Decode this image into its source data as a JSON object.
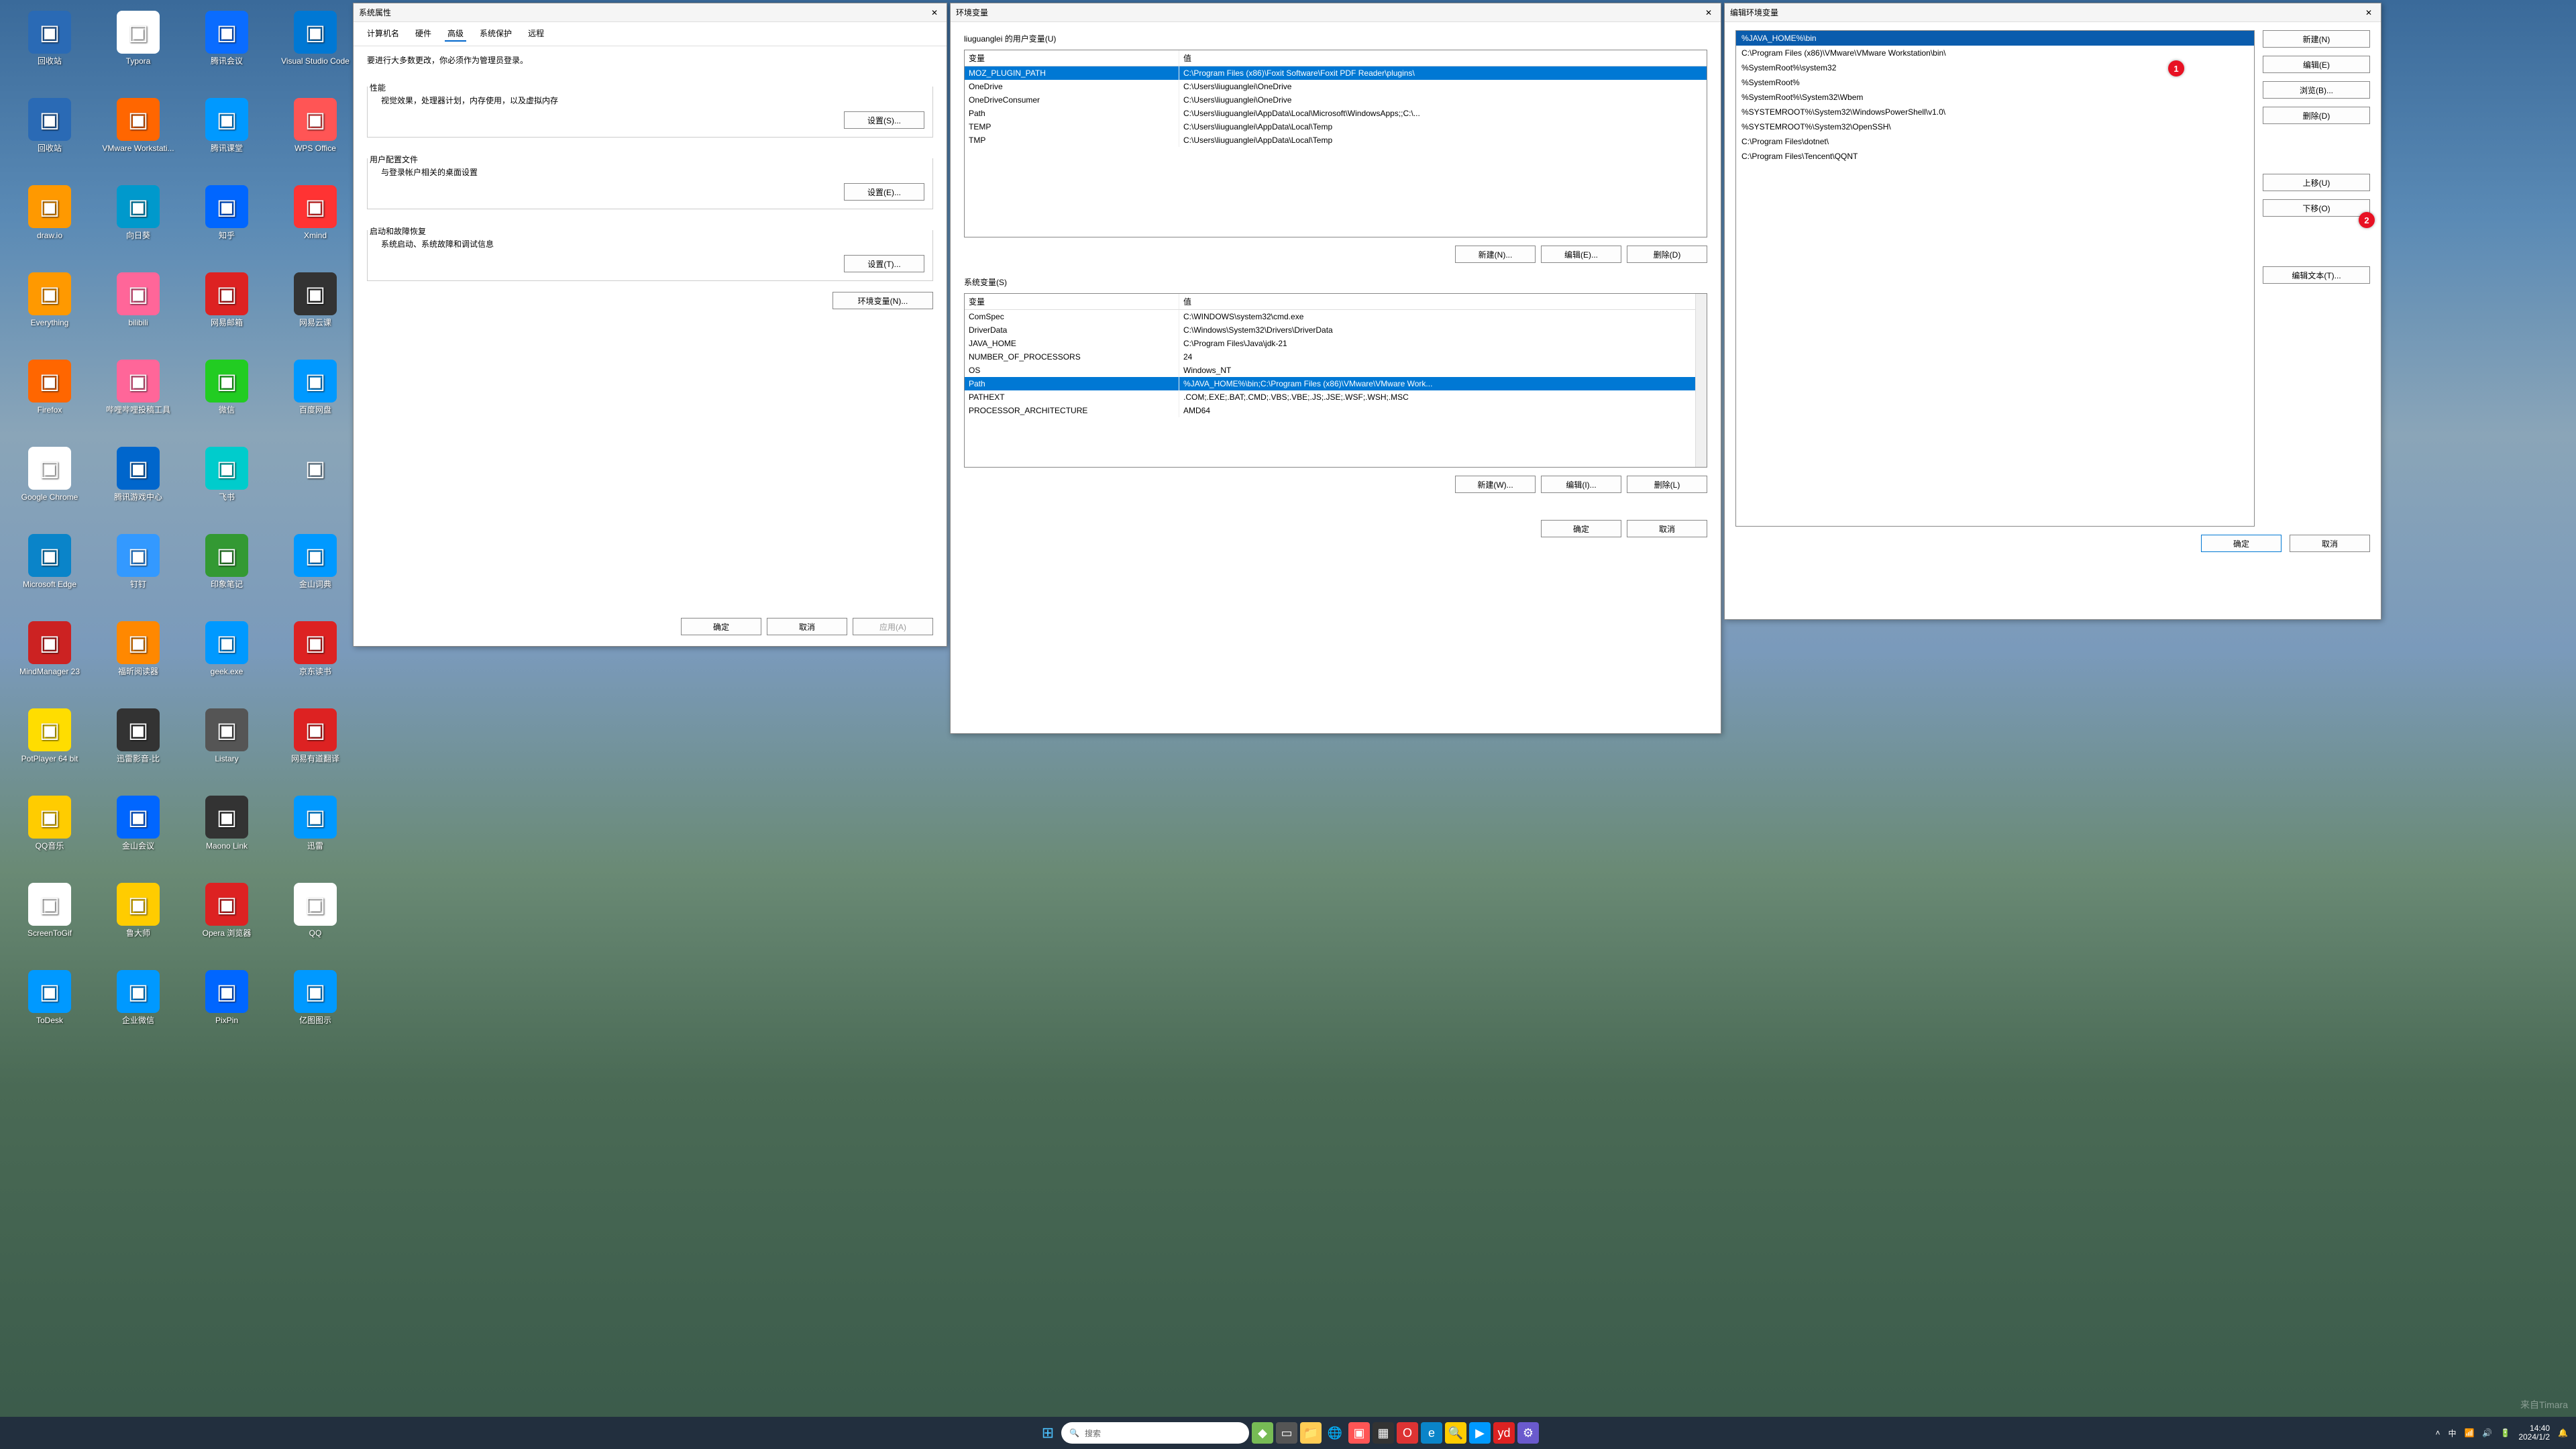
{
  "desktop_icons": [
    {
      "label": "回收站",
      "bg": "#2a6ab5"
    },
    {
      "label": "Typora",
      "bg": "#fff"
    },
    {
      "label": "腾讯会议",
      "bg": "#0a6cff"
    },
    {
      "label": "Visual Studio Code",
      "bg": "#0078d4"
    },
    {
      "label": "回收站",
      "bg": "#2a6ab5"
    },
    {
      "label": "VMware Workstati...",
      "bg": "#f60"
    },
    {
      "label": "腾讯课堂",
      "bg": "#09f"
    },
    {
      "label": "WPS Office",
      "bg": "#f55"
    },
    {
      "label": "draw.io",
      "bg": "#f90"
    },
    {
      "label": "向日葵",
      "bg": "#09c"
    },
    {
      "label": "知乎",
      "bg": "#06f"
    },
    {
      "label": "Xmind",
      "bg": "#f33"
    },
    {
      "label": "Everything",
      "bg": "#f90"
    },
    {
      "label": "bilibili",
      "bg": "#f69"
    },
    {
      "label": "网易邮箱",
      "bg": "#d22"
    },
    {
      "label": "网易云课",
      "bg": "#333"
    },
    {
      "label": "Firefox",
      "bg": "#f60"
    },
    {
      "label": "哔哩哔哩投稿工具",
      "bg": "#f69"
    },
    {
      "label": "微信",
      "bg": "#2c2"
    },
    {
      "label": "百度网盘",
      "bg": "#09f"
    },
    {
      "label": "Google Chrome",
      "bg": "#fff"
    },
    {
      "label": "腾讯游戏中心",
      "bg": "#06c"
    },
    {
      "label": "飞书",
      "bg": "#0cc"
    },
    {
      "label": "",
      "bg": "transparent"
    },
    {
      "label": "Microsoft Edge",
      "bg": "#0a84c9"
    },
    {
      "label": "钉钉",
      "bg": "#39f"
    },
    {
      "label": "印象笔记",
      "bg": "#393"
    },
    {
      "label": "金山词典",
      "bg": "#09f"
    },
    {
      "label": "MindManager 23",
      "bg": "#c22"
    },
    {
      "label": "福昕阅读器",
      "bg": "#f80"
    },
    {
      "label": "geek.exe",
      "bg": "#09f"
    },
    {
      "label": "京东读书",
      "bg": "#d22"
    },
    {
      "label": "PotPlayer 64 bit",
      "bg": "#fd0"
    },
    {
      "label": "迅雷影音-比",
      "bg": "#333"
    },
    {
      "label": "Listary",
      "bg": "#555"
    },
    {
      "label": "网易有道翻译",
      "bg": "#d22"
    },
    {
      "label": "QQ音乐",
      "bg": "#fc0"
    },
    {
      "label": "金山会议",
      "bg": "#06f"
    },
    {
      "label": "Maono Link",
      "bg": "#333"
    },
    {
      "label": "迅雷",
      "bg": "#09f"
    },
    {
      "label": "ScreenToGif",
      "bg": "#fff"
    },
    {
      "label": "鲁大师",
      "bg": "#fc0"
    },
    {
      "label": "Opera 浏览器",
      "bg": "#d22"
    },
    {
      "label": "QQ",
      "bg": "#fff"
    },
    {
      "label": "ToDesk",
      "bg": "#09f"
    },
    {
      "label": "企业微信",
      "bg": "#09f"
    },
    {
      "label": "PixPin",
      "bg": "#06f"
    },
    {
      "label": "亿图图示",
      "bg": "#09f"
    }
  ],
  "win1": {
    "title": "系统属性",
    "tabs": [
      "计算机名",
      "硬件",
      "高级",
      "系统保护",
      "远程"
    ],
    "active_tab": "高级",
    "note": "要进行大多数更改，你必须作为管理员登录。",
    "perf": {
      "title": "性能",
      "desc": "视觉效果，处理器计划，内存使用，以及虚拟内存",
      "btn": "设置(S)..."
    },
    "profile": {
      "title": "用户配置文件",
      "desc": "与登录帐户相关的桌面设置",
      "btn": "设置(E)..."
    },
    "startup": {
      "title": "启动和故障恢复",
      "desc": "系统启动、系统故障和调试信息",
      "btn": "设置(T)..."
    },
    "envbtn": "环境变量(N)...",
    "ok": "确定",
    "cancel": "取消",
    "apply": "应用(A)"
  },
  "win2": {
    "title": "环境变量",
    "user_label": "liuguanglei 的用户变量(U)",
    "col_var": "变量",
    "col_val": "值",
    "user_vars": [
      {
        "n": "MOZ_PLUGIN_PATH",
        "v": "C:\\Program Files (x86)\\Foxit Software\\Foxit PDF Reader\\plugins\\"
      },
      {
        "n": "OneDrive",
        "v": "C:\\Users\\liuguanglei\\OneDrive"
      },
      {
        "n": "OneDriveConsumer",
        "v": "C:\\Users\\liuguanglei\\OneDrive"
      },
      {
        "n": "Path",
        "v": "C:\\Users\\liuguanglei\\AppData\\Local\\Microsoft\\WindowsApps;;C:\\..."
      },
      {
        "n": "TEMP",
        "v": "C:\\Users\\liuguanglei\\AppData\\Local\\Temp"
      },
      {
        "n": "TMP",
        "v": "C:\\Users\\liuguanglei\\AppData\\Local\\Temp"
      }
    ],
    "new": "新建(N)...",
    "edit": "编辑(E)...",
    "del": "删除(D)",
    "sys_label": "系统变量(S)",
    "sys_vars": [
      {
        "n": "ComSpec",
        "v": "C:\\WINDOWS\\system32\\cmd.exe"
      },
      {
        "n": "DriverData",
        "v": "C:\\Windows\\System32\\Drivers\\DriverData"
      },
      {
        "n": "JAVA_HOME",
        "v": "C:\\Program Files\\Java\\jdk-21"
      },
      {
        "n": "NUMBER_OF_PROCESSORS",
        "v": "24"
      },
      {
        "n": "OS",
        "v": "Windows_NT"
      },
      {
        "n": "Path",
        "v": "%JAVA_HOME%\\bin;C:\\Program Files (x86)\\VMware\\VMware Work..."
      },
      {
        "n": "PATHEXT",
        "v": ".COM;.EXE;.BAT;.CMD;.VBS;.VBE;.JS;.JSE;.WSF;.WSH;.MSC"
      },
      {
        "n": "PROCESSOR_ARCHITECTURE",
        "v": "AMD64"
      }
    ],
    "new2": "新建(W)...",
    "edit2": "编辑(I)...",
    "del2": "删除(L)",
    "ok": "确定",
    "cancel": "取消"
  },
  "win3": {
    "title": "编辑环境变量",
    "paths": [
      "%JAVA_HOME%\\bin",
      "C:\\Program Files (x86)\\VMware\\VMware Workstation\\bin\\",
      "%SystemRoot%\\system32",
      "%SystemRoot%",
      "%SystemRoot%\\System32\\Wbem",
      "%SYSTEMROOT%\\System32\\WindowsPowerShell\\v1.0\\",
      "%SYSTEMROOT%\\System32\\OpenSSH\\",
      "C:\\Program Files\\dotnet\\",
      "C:\\Program Files\\Tencent\\QQNT"
    ],
    "new": "新建(N)",
    "edit": "编辑(E)",
    "browse": "浏览(B)...",
    "del": "删除(D)",
    "up": "上移(U)",
    "down": "下移(O)",
    "edittext": "编辑文本(T)...",
    "ok": "确定",
    "cancel": "取消"
  },
  "badges": {
    "b1": "1",
    "b2": "2"
  },
  "taskbar": {
    "search": "搜索",
    "time": "14:40",
    "date": "2024/1/2"
  },
  "watermark": "来自Timara"
}
